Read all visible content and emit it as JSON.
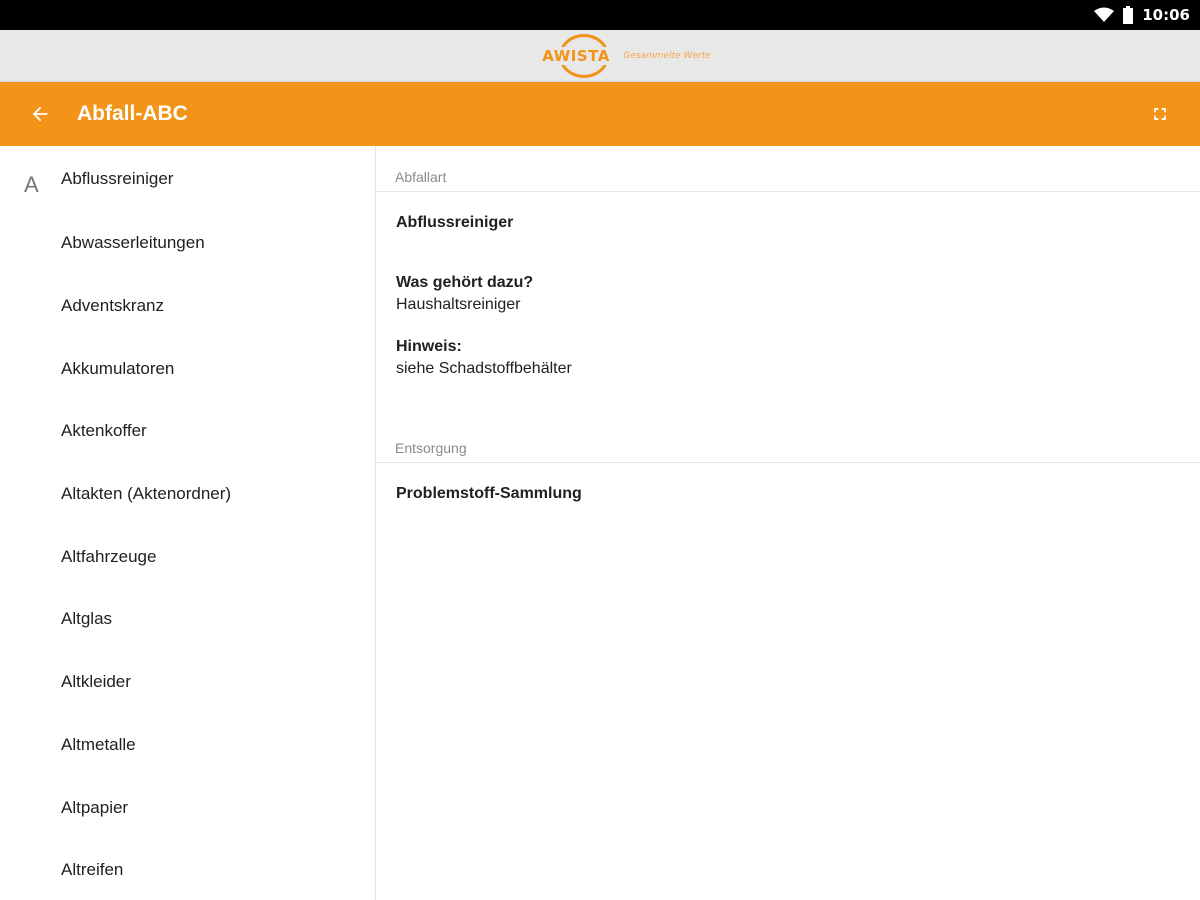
{
  "status_bar": {
    "time": "10:06"
  },
  "logo": {
    "brand": "AWISTA",
    "tagline": "Gesammelte Werte"
  },
  "app_bar": {
    "title": "Abfall-ABC"
  },
  "list": {
    "section_letter": "A",
    "items": [
      "Abflussreiniger",
      "Abwasserleitungen",
      "Adventskranz",
      "Akkumulatoren",
      "Aktenkoffer",
      "Altakten (Aktenordner)",
      "Altfahrzeuge",
      "Altglas",
      "Altkleider",
      "Altmetalle",
      "Altpapier",
      "Altreifen"
    ]
  },
  "detail": {
    "section1_header": "Abfallart",
    "item_name": "Abflussreiniger",
    "what_label": "Was gehört dazu?",
    "what_value": "Haushaltsreiniger",
    "hint_label": "Hinweis:",
    "hint_value": "siehe Schadstoffbehälter",
    "section2_header": "Entsorgung",
    "disposal_value": "Problemstoff-Sammlung"
  },
  "colors": {
    "accent": "#f39317",
    "status_bar": "#000000",
    "logo_bar": "#e8e8e8"
  }
}
